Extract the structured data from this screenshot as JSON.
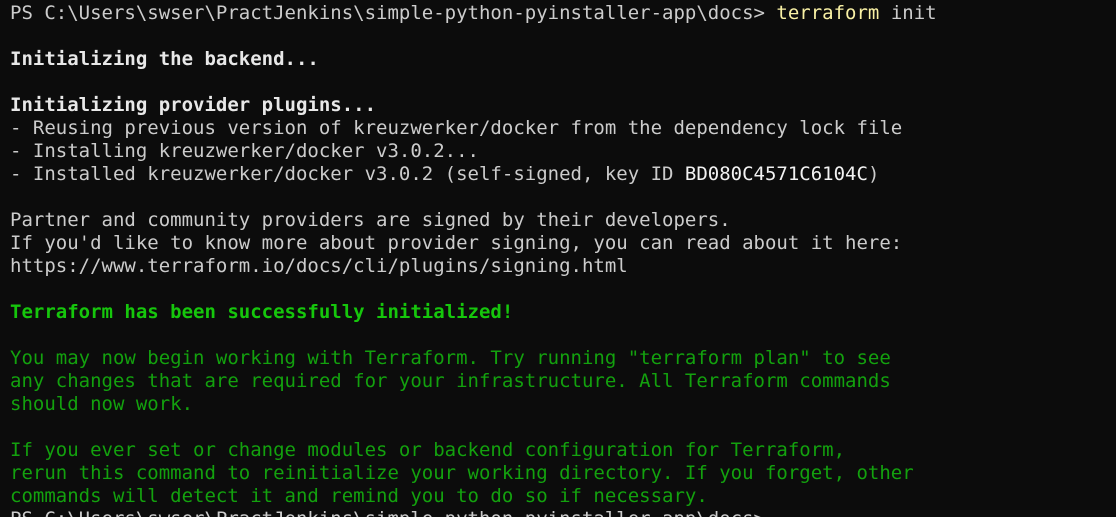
{
  "colors": {
    "background": "#0c0c0c",
    "foreground": "#cccccc",
    "green": "#13a10e",
    "command_yellow": "#f9f1a5"
  },
  "prompt": {
    "text": "PS C:\\Users\\swser\\PractJenkins\\simple-python-pyinstaller-app\\docs> ",
    "command": "terraform",
    "args": " init"
  },
  "output": {
    "backend": "Initializing the backend...",
    "provider_header": "Initializing provider plugins...",
    "reusing": "- Reusing previous version of kreuzwerker/docker from the dependency lock file",
    "installing": "- Installing kreuzwerker/docker v3.0.2...",
    "installed_prefix": "- Installed kreuzwerker/docker v3.0.2 (self-signed, key ID ",
    "key_id": "BD080C4571C6104C",
    "installed_suffix": ")",
    "partner": "Partner and community providers are signed by their developers.",
    "learn_more": "If you'd like to know more about provider signing, you can read about it here:",
    "signing_url": "https://www.terraform.io/docs/cli/plugins/signing.html",
    "success": "Terraform has been successfully initialized!",
    "begin_1": "You may now begin working with Terraform. Try running \"terraform plan\" to see",
    "begin_2": "any changes that are required for your infrastructure. All Terraform commands",
    "begin_3": "should now work.",
    "rerun_1": "If you ever set or change modules or backend configuration for Terraform,",
    "rerun_2": "rerun this command to reinitialize your working directory. If you forget, other",
    "rerun_3": "commands will detect it and remind you to do so if necessary."
  },
  "next_prompt": "PS C:\\Users\\swser\\PractJenkins\\simple-python-pyinstaller-app\\docs>"
}
